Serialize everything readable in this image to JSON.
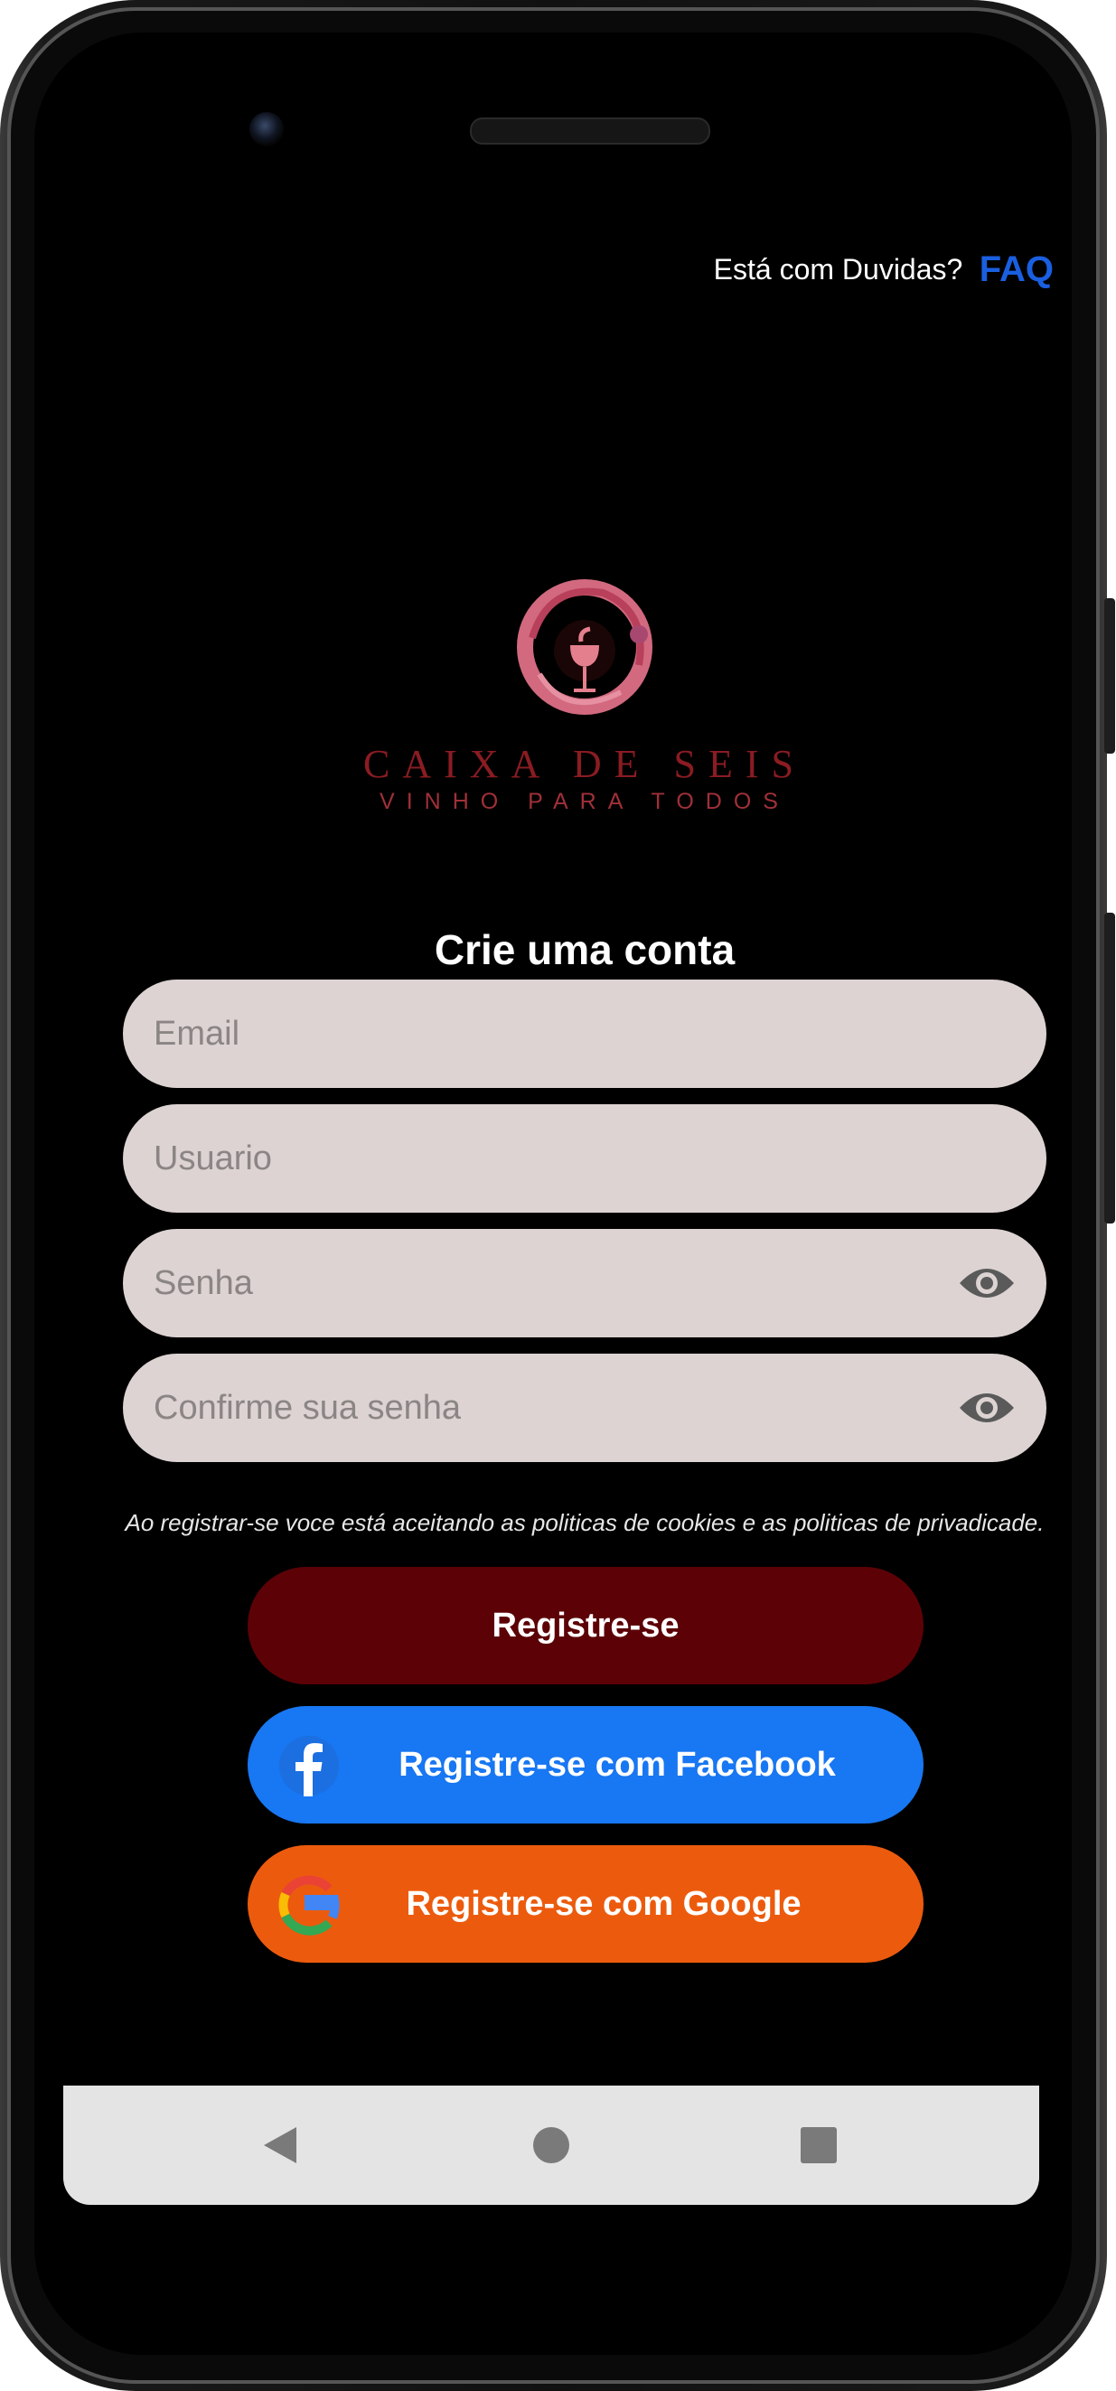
{
  "header": {
    "faq_question": "Está com Duvidas?",
    "faq_link": "FAQ"
  },
  "brand": {
    "name": "CAIXA DE SEIS",
    "tagline": "VINHO PARA TODOS"
  },
  "form": {
    "title": "Crie uma conta",
    "email_placeholder": "Email",
    "username_placeholder": "Usuario",
    "password_placeholder": "Senha",
    "confirm_password_placeholder": "Confirme sua senha",
    "terms_text": "Ao registrar-se voce está aceitando as politicas de cookies e as politicas de privadicade."
  },
  "actions": {
    "register_label": "Registre-se",
    "facebook_label": "Registre-se com Facebook",
    "google_label": "Registre-se com Google"
  },
  "colors": {
    "register": "#5c0206",
    "facebook": "#1877f2",
    "google": "#ec5b0d",
    "faq_link": "#1a5fe0",
    "input_bg": "#dcd3d2"
  },
  "navigation": {
    "back_icon": "triangle-back-icon",
    "home_icon": "circle-home-icon",
    "recents_icon": "square-recents-icon"
  }
}
